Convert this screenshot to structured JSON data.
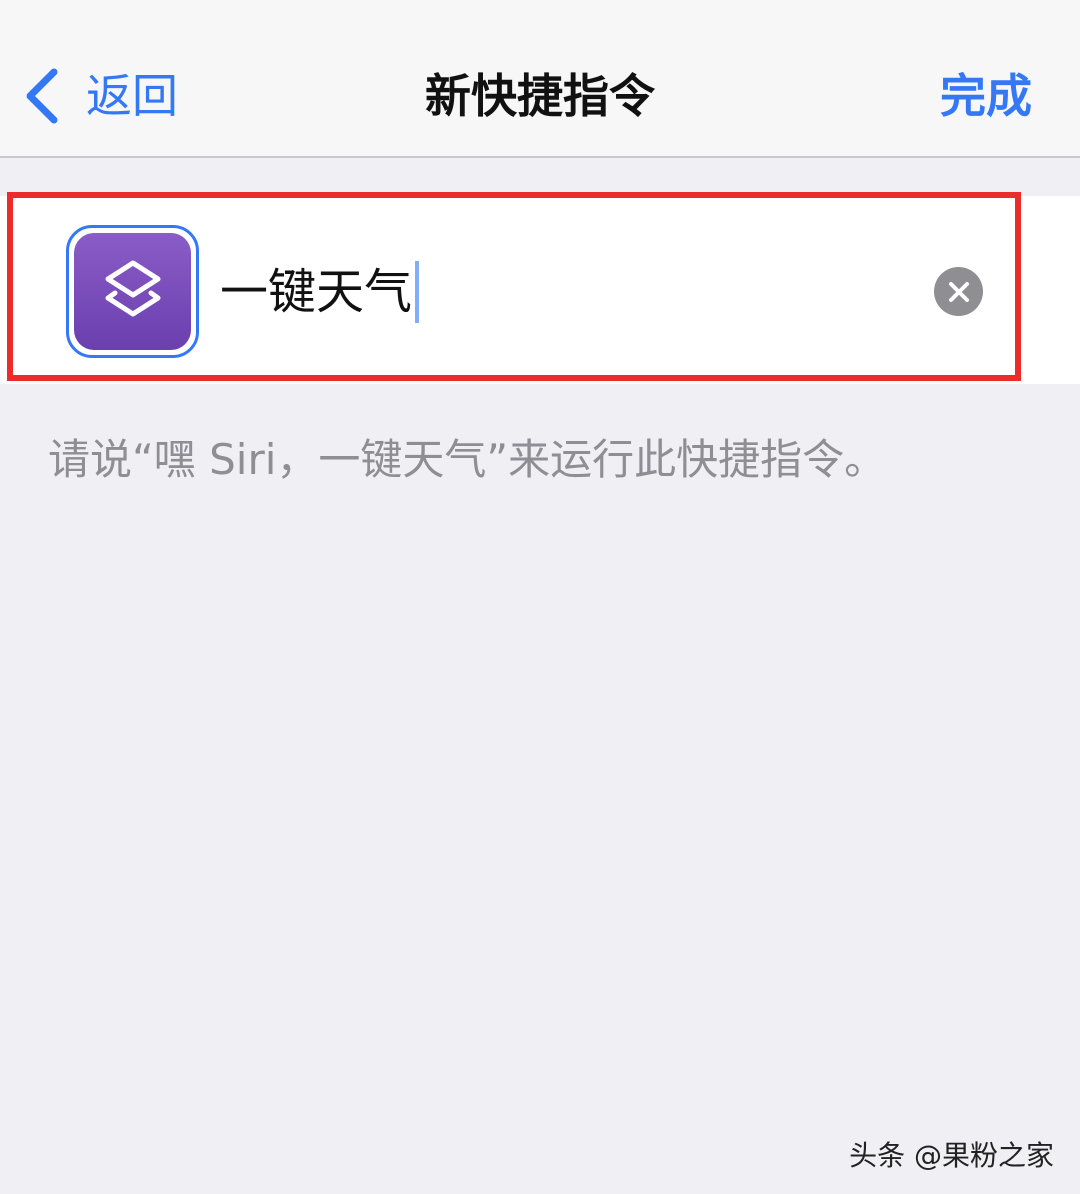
{
  "navbar": {
    "back_label": "返回",
    "title": "新快捷指令",
    "done_label": "完成"
  },
  "shortcut": {
    "icon": "layers-icon",
    "name_value": "一键天气"
  },
  "hint": {
    "text": "请说“嘿 Siri，一键天气”来运行此快捷指令。"
  },
  "watermark": {
    "text": "头条 @果粉之家"
  },
  "colors": {
    "accent": "#3478f6",
    "highlight": "#ee2b2b",
    "icon_purple": "#7a4dbd",
    "background": "#efeff4"
  }
}
